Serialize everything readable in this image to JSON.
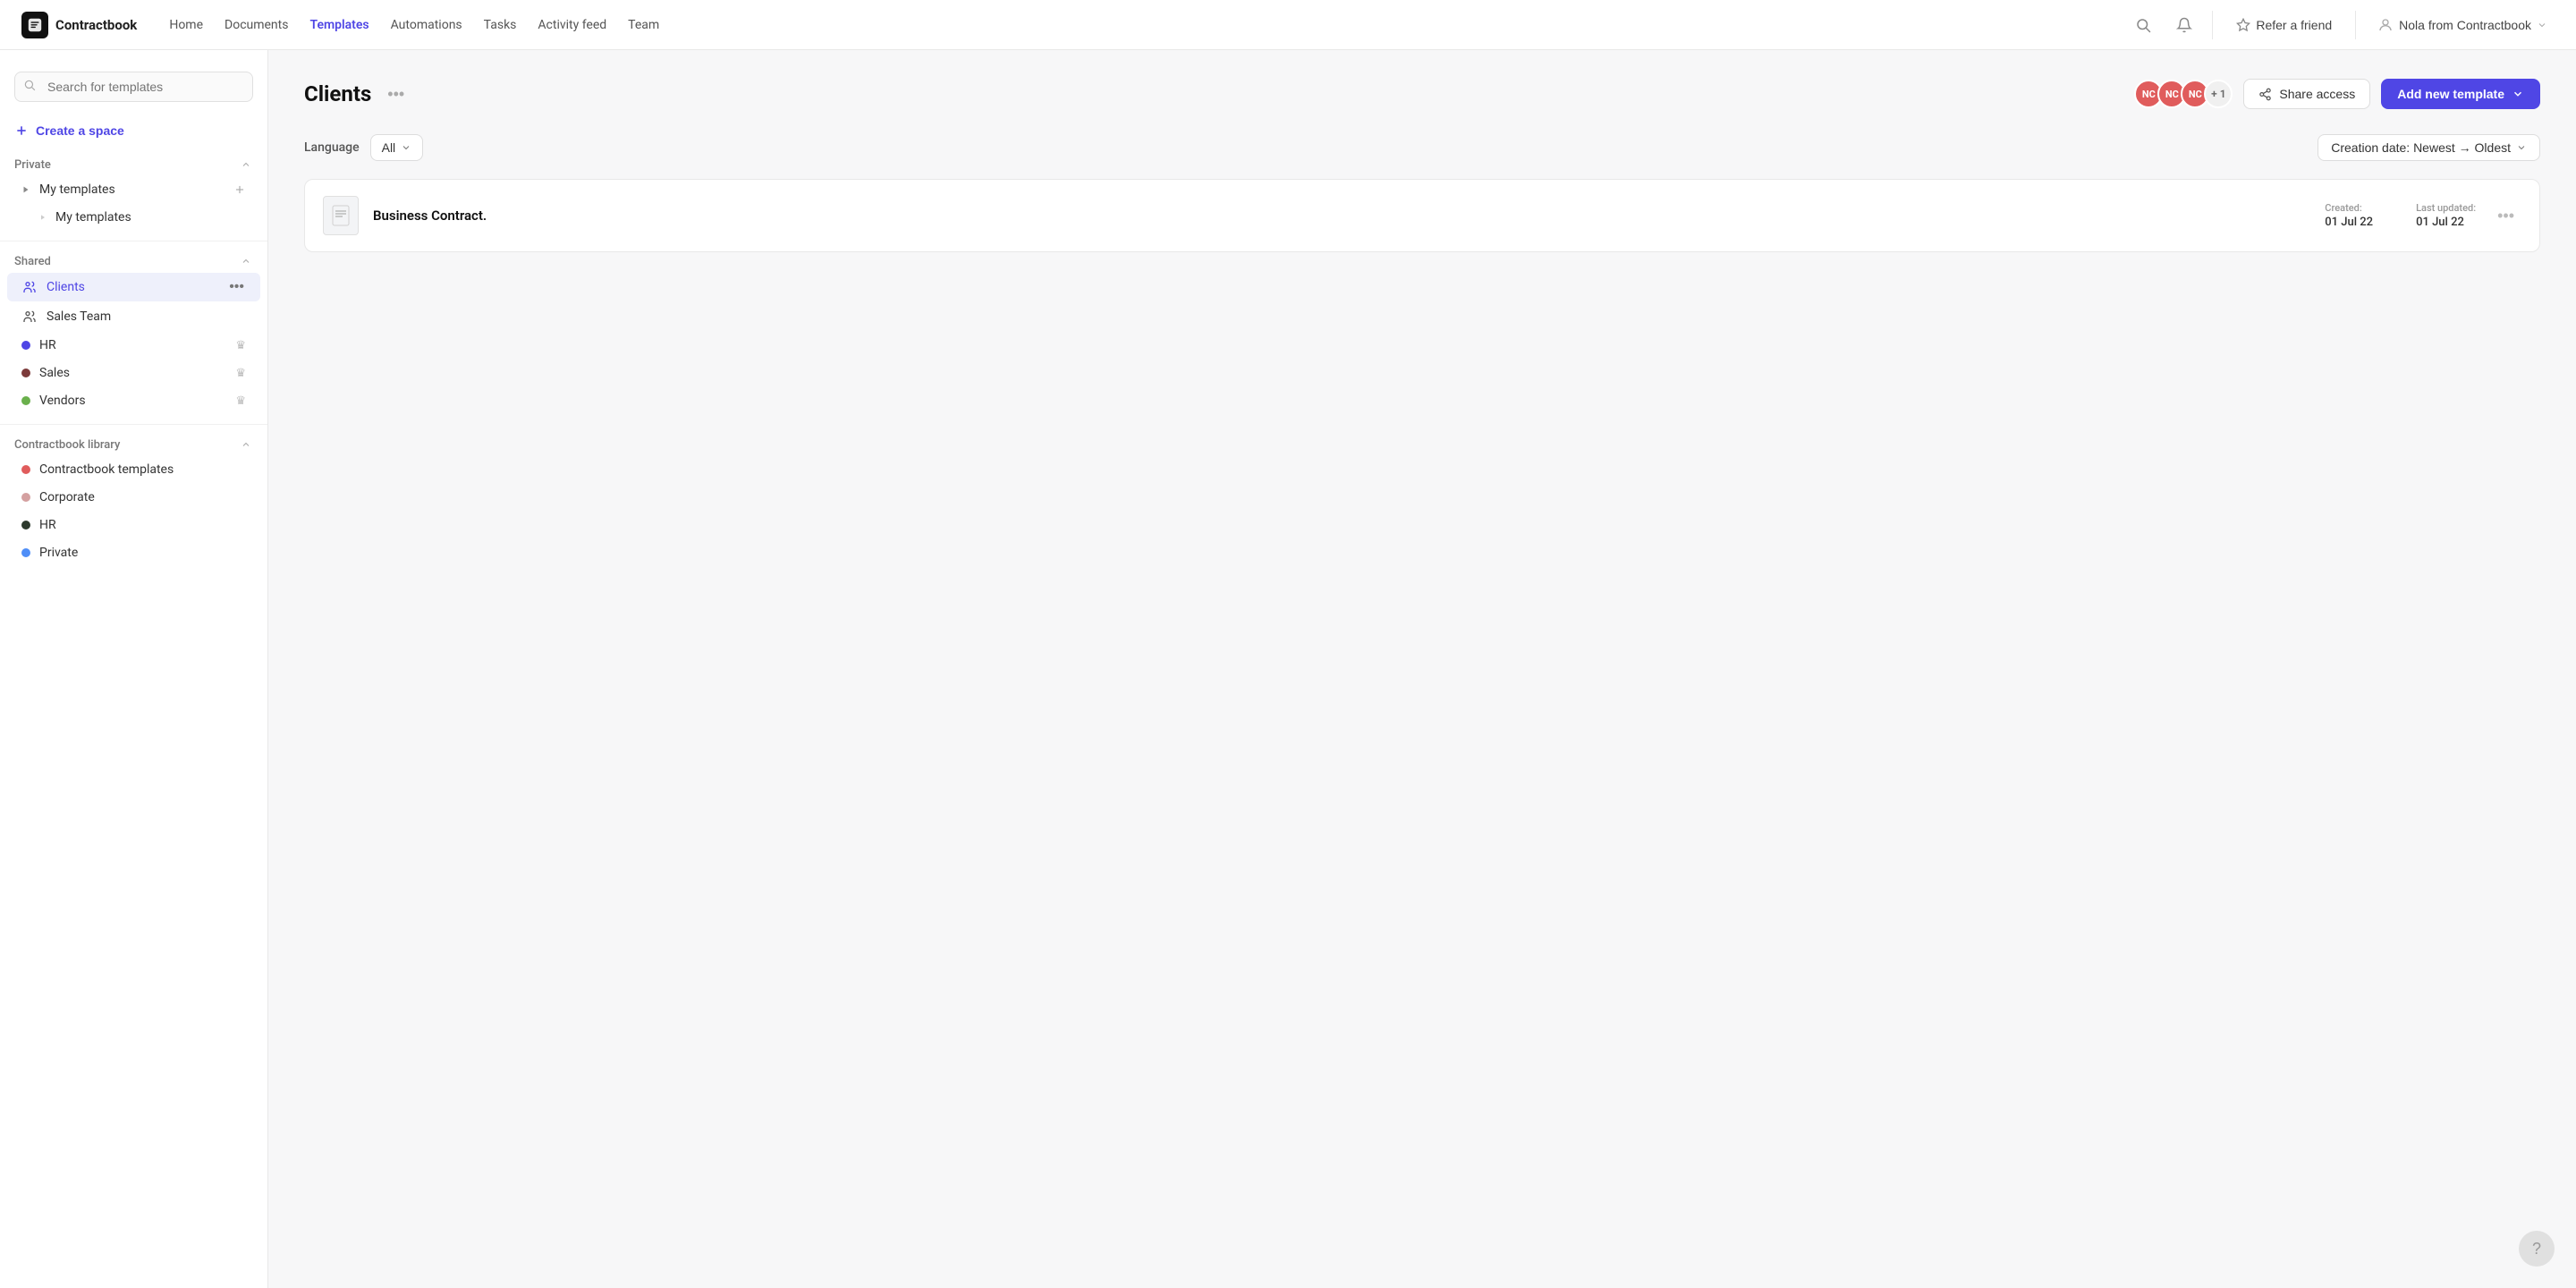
{
  "app": {
    "logo_text": "Contractbook",
    "logo_icon": "CB"
  },
  "nav": {
    "links": [
      {
        "label": "Home",
        "active": false
      },
      {
        "label": "Documents",
        "active": false
      },
      {
        "label": "Templates",
        "active": true
      },
      {
        "label": "Automations",
        "active": false
      },
      {
        "label": "Tasks",
        "active": false
      },
      {
        "label": "Activity feed",
        "active": false
      },
      {
        "label": "Team",
        "active": false
      }
    ],
    "refer_label": "Refer a friend",
    "user_label": "Nola from Contractbook"
  },
  "sidebar": {
    "search_placeholder": "Search for templates",
    "create_space_label": "Create a space",
    "sections": [
      {
        "name": "Private",
        "items": [
          {
            "label": "My templates",
            "type": "group",
            "expanded": true,
            "children": [
              {
                "label": "My templates",
                "type": "sub"
              }
            ]
          }
        ]
      },
      {
        "name": "Shared",
        "items": [
          {
            "label": "Clients",
            "type": "group-icon",
            "active": true,
            "dot_color": ""
          },
          {
            "label": "Sales Team",
            "type": "group-icon",
            "active": false,
            "dot_color": ""
          },
          {
            "label": "HR",
            "type": "dot",
            "dot_color": "#4f46e5",
            "crown": true
          },
          {
            "label": "Sales",
            "type": "dot",
            "dot_color": "#7c3a3a",
            "crown": true
          },
          {
            "label": "Vendors",
            "type": "dot",
            "dot_color": "#6ab04c",
            "crown": true
          }
        ]
      },
      {
        "name": "Contractbook library",
        "items": [
          {
            "label": "Contractbook templates",
            "type": "dot",
            "dot_color": "#e05c5c"
          },
          {
            "label": "Corporate",
            "type": "dot",
            "dot_color": "#d4a0a0"
          },
          {
            "label": "HR",
            "type": "dot",
            "dot_color": "#2d3a2d"
          },
          {
            "label": "Private",
            "type": "dot",
            "dot_color": "#4f8ef7"
          }
        ]
      }
    ]
  },
  "main": {
    "title": "Clients",
    "avatars": [
      "NC",
      "NC",
      "NC"
    ],
    "avatar_extra": "+ 1",
    "share_access_label": "Share access",
    "add_template_label": "Add new template",
    "language_label": "Language",
    "language_value": "All",
    "sort_label": "Creation date: Newest → Oldest",
    "templates": [
      {
        "name": "Business Contract.",
        "created_label": "Created:",
        "created_value": "01 Jul 22",
        "updated_label": "Last updated:",
        "updated_value": "01 Jul 22"
      }
    ]
  },
  "help": {
    "icon": "?"
  }
}
